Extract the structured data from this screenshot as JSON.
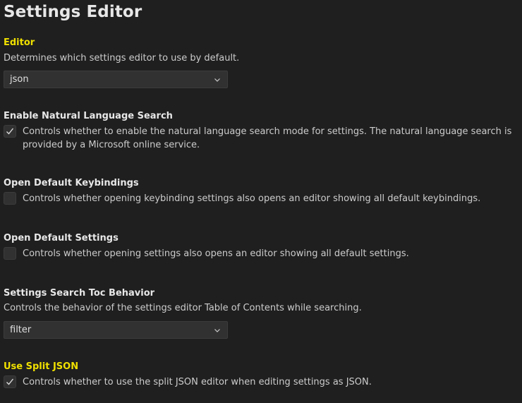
{
  "page": {
    "title": "Settings Editor"
  },
  "settings": [
    {
      "title": "Editor",
      "modified": true,
      "description": "Determines which settings editor to use by default.",
      "type": "select",
      "value": "json"
    },
    {
      "title": "Enable Natural Language Search",
      "modified": false,
      "description": "Controls whether to enable the natural language search mode for settings. The natural language search is provided by a Microsoft online service.",
      "type": "checkbox",
      "checked": true
    },
    {
      "title": "Open Default Keybindings",
      "modified": false,
      "description": "Controls whether opening keybinding settings also opens an editor showing all default keybindings.",
      "type": "checkbox",
      "checked": false
    },
    {
      "title": "Open Default Settings",
      "modified": false,
      "description": "Controls whether opening settings also opens an editor showing all default settings.",
      "type": "checkbox",
      "checked": false
    },
    {
      "title": "Settings Search Toc Behavior",
      "modified": false,
      "description": "Controls the behavior of the settings editor Table of Contents while searching.",
      "type": "select",
      "value": "filter"
    },
    {
      "title": "Use Split JSON",
      "modified": true,
      "description": "Controls whether to use the split JSON editor when editing settings as JSON.",
      "type": "checkbox",
      "checked": true
    }
  ],
  "colors": {
    "background": "#1f1f1f",
    "modified_title": "#f0e000",
    "control_background": "#313131",
    "control_border": "#3c3c3c"
  },
  "icons": {
    "check": "check-icon",
    "chevron": "chevron-down-icon"
  }
}
